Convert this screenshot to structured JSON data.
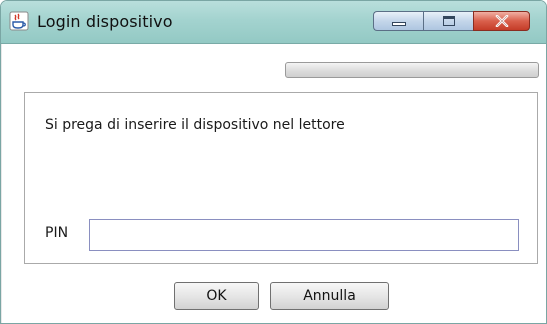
{
  "window": {
    "title": "Login dispositivo",
    "app_icon": "java-cup-icon",
    "controls": [
      "minimize-icon",
      "maximize-icon",
      "close-icon"
    ]
  },
  "progress": {
    "value": 0
  },
  "message": "Si prega di inserire il dispositivo nel lettore",
  "pin": {
    "label": "PIN",
    "value": ""
  },
  "buttons": {
    "ok_label": "OK",
    "cancel_label": "Annulla"
  },
  "colors": {
    "titlebar": "#a3d3cf",
    "close": "#d9604c",
    "input_border": "#8a8fc0"
  }
}
